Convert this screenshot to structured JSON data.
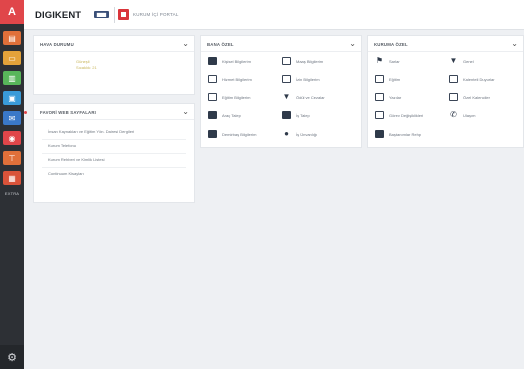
{
  "header": {
    "brand": "DIGIKENT",
    "badge": "▇▇▇",
    "portal_label": "KURUM İÇİ PORTAL"
  },
  "sidebar": {
    "top_icon": "A",
    "extra_label": "EXTRA",
    "items": [
      {
        "icon": "doc-icon",
        "color": "#e0703a"
      },
      {
        "icon": "folder-icon",
        "color": "#e3a23a"
      },
      {
        "icon": "chart-icon",
        "color": "#58b65a"
      },
      {
        "icon": "window-icon",
        "color": "#3a9bd8"
      },
      {
        "icon": "mail-icon",
        "color": "#3a78c8"
      },
      {
        "icon": "shield-icon",
        "color": "#e0464a"
      },
      {
        "icon": "tag-icon",
        "color": "#e0703a"
      },
      {
        "icon": "report-icon",
        "color": "#d9533a"
      }
    ]
  },
  "weather": {
    "title": "HAVA DURUMU",
    "line1": "Güneşli",
    "line2": "Sıcaklık: 21"
  },
  "favorites": {
    "title": "FAVORİ WEB SAYFALARI",
    "links": [
      "İnsan Kaynakları ve Eğitim Yön. Dairesi Dergileri",
      "Kurum Telefonu",
      "Kurum Rehberi ve Kimlik Listesi",
      "Continuum Kisayları"
    ]
  },
  "personal": {
    "title": "BANA ÖZEL",
    "items": [
      {
        "label": "Kişisel Bilgilerim",
        "icon": "person-card-icon",
        "style": "dark"
      },
      {
        "label": "Maaş Bilgilerim",
        "icon": "document-icon",
        "style": "outline"
      },
      {
        "label": "Hizmet Bilgilerim",
        "icon": "list-icon",
        "style": "outline"
      },
      {
        "label": "İzin Bilgilerim",
        "icon": "list-icon",
        "style": "outline"
      },
      {
        "label": "Eğitim Bilgilerim",
        "icon": "book-icon",
        "style": "outline"
      },
      {
        "label": "Ödül ve Cezalar",
        "icon": "trophy-icon",
        "style": "glyph"
      },
      {
        "label": "Araç Talep",
        "icon": "car-icon",
        "style": "dark"
      },
      {
        "label": "İş Talep",
        "icon": "briefcase-icon",
        "style": "dark"
      },
      {
        "label": "Demirbaş Bilgilerim",
        "icon": "box-icon",
        "style": "dark"
      },
      {
        "label": "İş Ünvanlığı",
        "icon": "user-icon",
        "style": "glyph"
      }
    ]
  },
  "institution": {
    "title": "KURUMA ÖZEL",
    "items": [
      {
        "label": "Sarlar",
        "icon": "flag-icon",
        "style": "glyph"
      },
      {
        "label": "Genel",
        "icon": "trophy-icon",
        "style": "glyph"
      },
      {
        "label": "Eğitim",
        "icon": "book-icon",
        "style": "outline"
      },
      {
        "label": "Kalenteli Duyurlar",
        "icon": "calendar-icon",
        "style": "outline"
      },
      {
        "label": "Yazılar",
        "icon": "list-icon",
        "style": "outline"
      },
      {
        "label": "Özel Kalenciler",
        "icon": "calendar-icon",
        "style": "outline"
      },
      {
        "label": "Görev Değişiklikleri",
        "icon": "list-icon",
        "style": "outline"
      },
      {
        "label": "Ulaşım",
        "icon": "phone-icon",
        "style": "glyph"
      },
      {
        "label": "Baştanımlar Rehp",
        "icon": "card-icon",
        "style": "dark"
      }
    ]
  }
}
